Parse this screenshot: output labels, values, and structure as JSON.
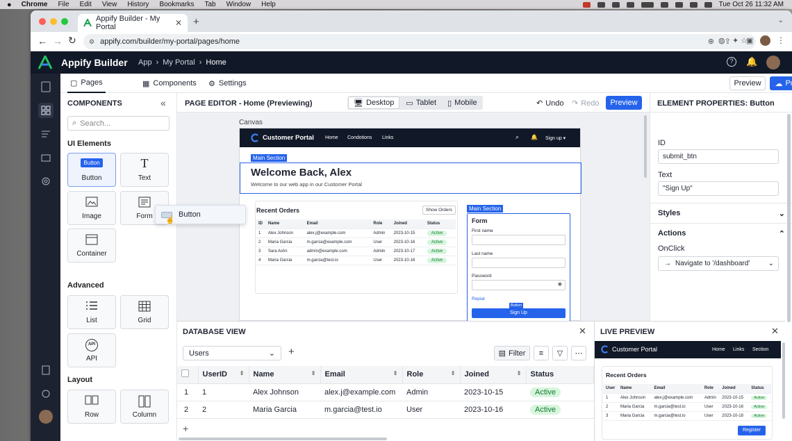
{
  "menubar": {
    "app": "Chrome",
    "items": [
      "File",
      "Edit",
      "View",
      "History",
      "Bookmarks",
      "Tab",
      "Window",
      "Help"
    ],
    "datetime": "Tue Oct 26  11:32 AM"
  },
  "browser": {
    "tab_title": "Appify Builder - My Portal",
    "url": "appify.com/builder/my-portal/pages/home"
  },
  "app": {
    "name": "Appify Builder",
    "breadcrumb": [
      "App",
      "My Portal",
      "Home"
    ],
    "colors": {
      "header": "#111827",
      "accent": "#2563eb",
      "logo": "#22c55e"
    }
  },
  "top_tabs": {
    "pages": "Pages",
    "components": "Components",
    "settings": "Settings"
  },
  "top_actions": {
    "preview": "Preview",
    "publish": "Publish"
  },
  "components_panel": {
    "title": "COMPONENTS",
    "search_placeholder": "Search...",
    "ui_section": "UI Elements",
    "button_preview": "Button",
    "ui_items": [
      "Button",
      "Text",
      "Image",
      "Form",
      "Container"
    ],
    "advanced_section": "Advanced",
    "advanced_items": [
      "List",
      "Grid",
      "API"
    ],
    "api_badge": "API",
    "layout_section": "Layout",
    "layout_items": [
      "Row",
      "Column"
    ],
    "drag_label": "Button"
  },
  "editor": {
    "title": "PAGE EDITOR - Home (Previewing)",
    "devices": [
      "Desktop",
      "Tablet",
      "Mobile"
    ],
    "undo": "Undo",
    "redo": "Redo",
    "preview": "Preview",
    "canvas_label": "Canvas"
  },
  "canvas": {
    "brand": "Customer Portal",
    "nav": [
      "Home",
      "Condotions",
      "Links"
    ],
    "signup": "Sign up ▾",
    "section_tag": "Main Section",
    "welcome_title": "Welcome Back, Alex",
    "welcome_sub": "Welcome to our web app in our Customer Portal",
    "orders_title": "Recent Orders",
    "show_orders": "Show Orders",
    "order_headers": [
      "ID",
      "Name",
      "Email",
      "Role",
      "Joined",
      "Status"
    ],
    "orders": [
      [
        "1",
        "Alex Johnson",
        "alex.j@example.com",
        "Admin",
        "2023-10-15",
        "Active"
      ],
      [
        "2",
        "Maria Garcia",
        "m.garcia@example.com",
        "User",
        "2023-10-16",
        "Active"
      ],
      [
        "3",
        "Sara Ashn",
        "admin@example.com",
        "Admin",
        "2023-10-17",
        "Active"
      ],
      [
        "4",
        "Maria Garcia",
        "m.garcia@test.io",
        "User",
        "2023-10-16",
        "Active"
      ]
    ],
    "form_section_tag": "Main Section",
    "form_title": "Form",
    "first_name": "First name",
    "last_name": "Last name",
    "password": "Password",
    "repiat": "Repiat",
    "button_tag": "Button",
    "signup_btn": "Sign Up"
  },
  "properties": {
    "title": "ELEMENT PROPERTIES: Button",
    "id_label": "ID",
    "id_value": "submit_btn",
    "text_label": "Text",
    "text_value": "\"Sign Up\"",
    "styles": "Styles",
    "actions": "Actions",
    "onclick": "OnClick",
    "onclick_value": "Navigate to '/dashboard'"
  },
  "database": {
    "title": "DATABASE VIEW",
    "table_select": "Users",
    "filter": "Filter",
    "headers": [
      "UserID",
      "Name",
      "Email",
      "Role",
      "Joined",
      "Status"
    ],
    "rows": [
      [
        "1",
        "1",
        "Alex Johnson",
        "alex.j@example.com",
        "Admin",
        "2023-10-15",
        "Active"
      ],
      [
        "2",
        "2",
        "Maria Garcia",
        "m.garcia@test.io",
        "User",
        "2023-10-16",
        "Active"
      ]
    ]
  },
  "live_preview": {
    "title": "LIVE PREVIEW",
    "brand": "Customer Portal",
    "nav": [
      "Home",
      "Links",
      "Section"
    ],
    "orders_title": "Recent Orders",
    "headers": [
      "User",
      "Name",
      "Email",
      "Role",
      "Joined",
      "Status"
    ],
    "rows": [
      [
        "1",
        "Alex Johnson",
        "alex.j@example.com",
        "Admin",
        "2023-10-15",
        "Active"
      ],
      [
        "2",
        "Maria Garcia",
        "m.garcia@test.io",
        "User",
        "2023-10-16",
        "Active"
      ],
      [
        "3",
        "Maria Garcia",
        "m.garcia@test.io",
        "User",
        "2023-10-18",
        "Active"
      ]
    ],
    "register": "Register"
  }
}
